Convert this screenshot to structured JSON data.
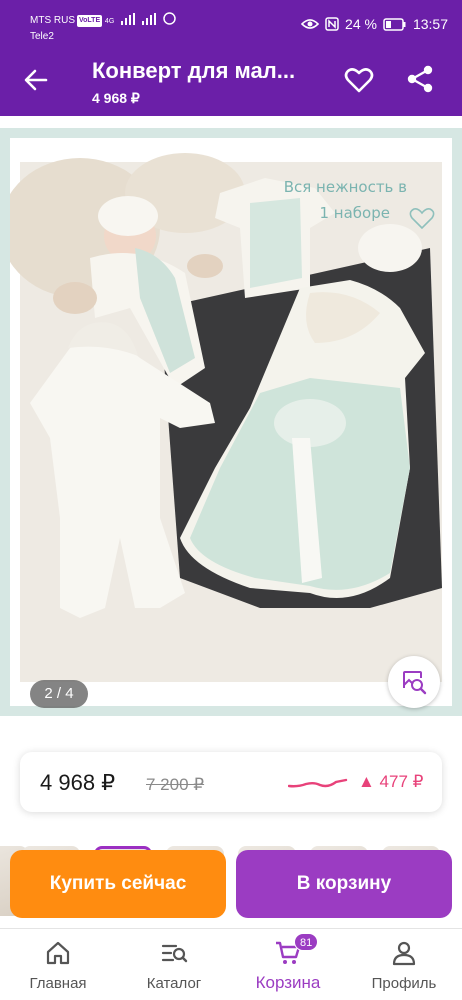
{
  "status_bar": {
    "operator1": "MTS RUS",
    "volte_badge": "VoLTE",
    "network": "4G",
    "operator2": "Tele2",
    "battery": "24 %",
    "time": "13:57"
  },
  "app_bar": {
    "title": "Конверт для мал...",
    "price": "4 968 ₽",
    "icons": [
      "back-arrow-icon",
      "heart-icon",
      "share-icon"
    ]
  },
  "gallery": {
    "overlay_text_line1": "Вся нежность в",
    "overlay_text_line2": "1 наборе",
    "counter": "2 / 4",
    "photo_count": 4,
    "current_photo": 2,
    "search_by_photo_icon": "image-search-icon",
    "background_color": "#d6e7e3"
  },
  "price_card": {
    "current_price": "4 968 ₽",
    "old_price": "7 200 ₽",
    "price_change": "▲ 477 ₽",
    "accent_color": "#e8427a"
  },
  "actions": {
    "buy_now": "Купить сейчас",
    "add_to_cart": "В корзину",
    "buy_color": "#ff8c10",
    "cart_color": "#9b3cc2"
  },
  "bottom_nav": {
    "items": [
      {
        "label": "Главная",
        "icon": "home-icon"
      },
      {
        "label": "Каталог",
        "icon": "catalog-search-icon"
      },
      {
        "label": "Корзина",
        "icon": "cart-icon",
        "badge": "81",
        "active": true
      },
      {
        "label": "Профиль",
        "icon": "profile-icon"
      }
    ]
  },
  "colors": {
    "brand_purple": "#6b1fa8",
    "accent_purple": "#9b3cc2"
  }
}
